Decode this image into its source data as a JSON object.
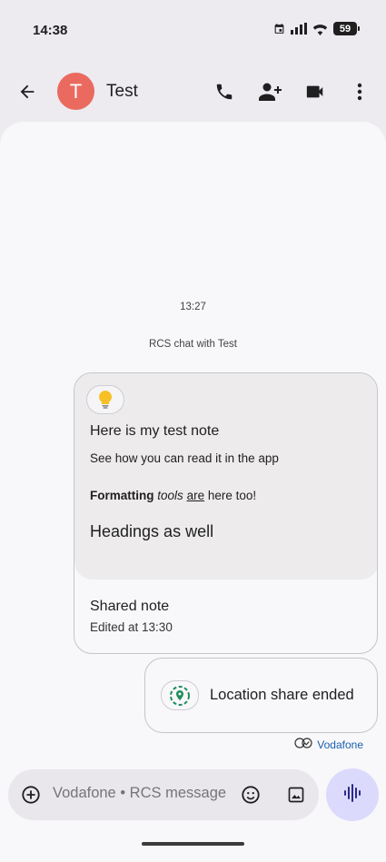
{
  "status_bar": {
    "time": "14:38",
    "battery": "59",
    "icons": [
      "calendar-icon",
      "signal-icon",
      "wifi-icon",
      "battery-icon"
    ]
  },
  "header": {
    "back_icon": "arrow-back-icon",
    "avatar_letter": "T",
    "avatar_color": "#ea6a5f",
    "contact_name": "Test",
    "actions": [
      "phone-icon",
      "add-person-icon",
      "video-icon",
      "more-vert-icon"
    ]
  },
  "conversation": {
    "timestamp": "13:27",
    "chat_type_label": "RCS chat with Test",
    "note_card": {
      "icon": "lightbulb-icon",
      "title": "Here is my test note",
      "body": "See how you can read it in the app",
      "format_bold": "Formatting",
      "format_italic": "tools",
      "format_underline": "are",
      "format_rest": "here too!",
      "heading": "Headings as well",
      "shared_label": "Shared note",
      "edited_label": "Edited at 13:30"
    },
    "location_card": {
      "icon": "location-share-icon",
      "label": "Location share ended"
    },
    "delivery_label": "Vodafone"
  },
  "composer": {
    "placeholder": "Vodafone • RCS message",
    "add_icon": "add-circle-icon",
    "emoji_icon": "emoji-icon",
    "gallery_icon": "gallery-icon",
    "voice_icon": "voice-waveform-icon"
  },
  "colors": {
    "accent": "#dcdafc",
    "delivery_link": "#1a5fb0",
    "location_green": "#1e8e5a"
  }
}
